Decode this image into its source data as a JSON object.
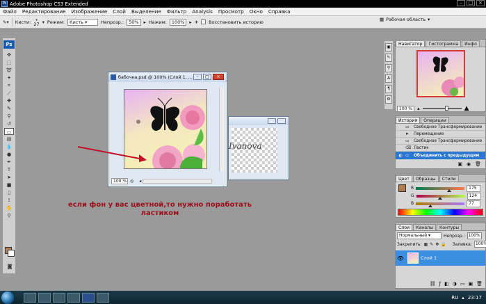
{
  "app": {
    "title": "Adobe Photoshop CS3 Extended",
    "icon_text": "Ps"
  },
  "menu": [
    "Файл",
    "Редактирование",
    "Изображение",
    "Слой",
    "Выделение",
    "Фильтр",
    "Analysis",
    "Просмотр",
    "Окно",
    "Справка"
  ],
  "options_bar": {
    "brushes_label": "Кисти:",
    "brush_size": "27",
    "mode_label": "Режим:",
    "mode_value": "Кисть",
    "opacity_label": "Непрозр.:",
    "opacity_value": "50%",
    "pressure_label": "Нажим:",
    "pressure_value": "100%",
    "restore_history_label": "Восстановить историю",
    "workspace_label": "Рабочая область"
  },
  "document": {
    "title": "бабочка.psd @ 100% (Слой 1, ...",
    "zoom": "100 %"
  },
  "document2": {
    "watermark": "Ivanova"
  },
  "caption": "если фон у вас цветной,то нужно поработать ластиком",
  "navigator": {
    "tabs": [
      "Навигатор",
      "Гистограмма",
      "Инфо"
    ],
    "zoom": "100 %"
  },
  "history": {
    "tabs": [
      "История",
      "Операции"
    ],
    "items": [
      "Свободное Трансформирование",
      "Перемещение",
      "Свободное Трансформирование",
      "Ластик",
      "Объединить с предыдущим"
    ]
  },
  "color": {
    "tabs": [
      "Цвет",
      "Образцы",
      "Стили"
    ],
    "r_label": "R",
    "g_label": "G",
    "b_label": "B",
    "r": "175",
    "g": "124",
    "b": "77",
    "r_level": 0.686,
    "g_level": 0.486,
    "b_level": 0.302
  },
  "layers": {
    "tabs": [
      "Слои",
      "Каналы",
      "Контуры"
    ],
    "blend_mode": "Нормальный",
    "opacity_label": "Непрозр.:",
    "opacity_value": "100%",
    "lock_label": "Закрепить:",
    "fill_label": "Заливка:",
    "fill_value": "100%",
    "layer_name": "Слой 1"
  },
  "taskbar": {
    "lang": "RU",
    "time": "23:17"
  }
}
